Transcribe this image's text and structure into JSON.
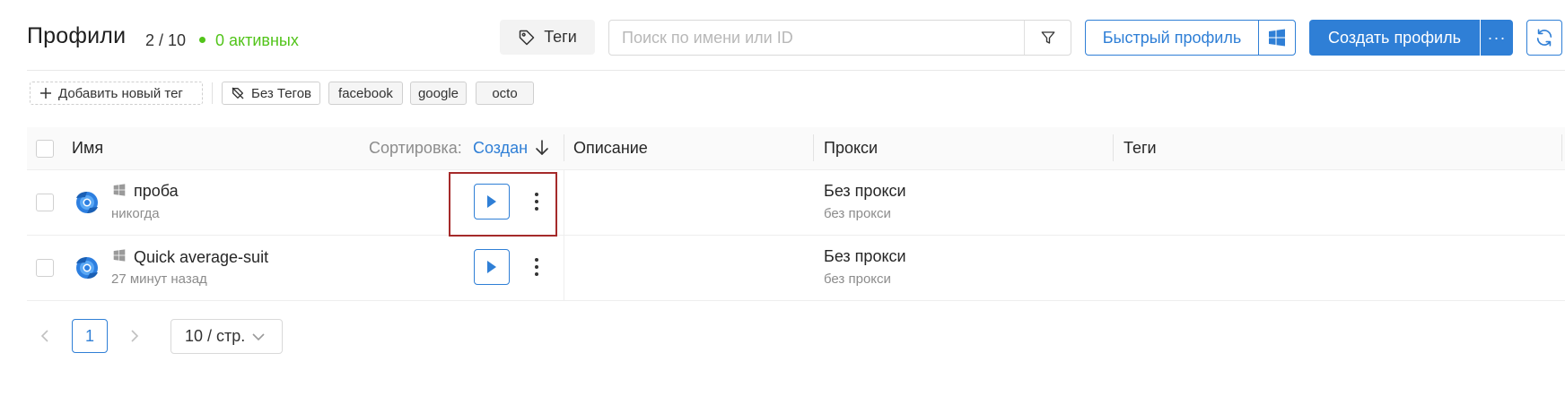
{
  "header": {
    "title": "Профили",
    "count": "2 / 10",
    "active": "0 активных",
    "tags_button": "Теги",
    "search_placeholder": "Поиск по имени или ID",
    "quick_profile": "Быстрый профиль",
    "create_profile": "Создать профиль",
    "more": "···"
  },
  "tagbar": {
    "add_tag": "Добавить новый тег",
    "tags": [
      "Без Тегов",
      "facebook",
      "google",
      "octo"
    ]
  },
  "table": {
    "columns": {
      "name": "Имя",
      "sort_label": "Сортировка:",
      "sort_value": "Создан",
      "description": "Описание",
      "proxy": "Прокси",
      "tags": "Теги"
    },
    "rows": [
      {
        "name": "проба",
        "last_run": "никогда",
        "proxy": "Без прокси",
        "proxy_sub": "без прокси"
      },
      {
        "name": "Quick average-suit",
        "last_run": "27 минут назад",
        "proxy": "Без прокси",
        "proxy_sub": "без прокси"
      }
    ]
  },
  "pagination": {
    "current_page": "1",
    "page_size": "10 / стр."
  },
  "colors": {
    "accent": "#2f7fd6",
    "active_green": "#52c41a",
    "highlight": "#a52a2a"
  }
}
